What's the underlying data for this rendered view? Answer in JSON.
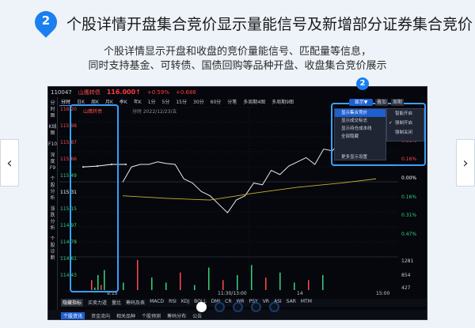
{
  "header": {
    "badge_number": "2",
    "title": "个股详情开盘集合竞价显示量能信号及新增部分证券集合竞价",
    "subtitle_line1": "个股详情显示开盘和收盘的竞价量能信号、匹配量等信息，",
    "subtitle_line2": "同时支持基金、可转债、国债回购等品种开盘、收盘集合竞价展示"
  },
  "nav": {
    "prev": "‹",
    "next": "›"
  },
  "terminal": {
    "code": "110047",
    "name": "山鹰转债",
    "price": "116.000↑",
    "change_pct": "+0.59%",
    "change_abs": "+0.686",
    "left_tabs": [
      "分时图",
      "K线图",
      "F10",
      "深度F9",
      "个股分析",
      "涨跌分析",
      "个股诊断"
    ],
    "period_tabs": [
      "分时",
      "日K",
      "周K",
      "月K",
      "季K",
      "年K",
      "1分",
      "5分",
      "15分",
      "30分",
      "60分",
      "分笔",
      "多周期4图",
      "多周期9图"
    ],
    "auction_label": "山鹰转债",
    "date_label": "分时 2022/12/23/五",
    "left_axis": [
      "116.20",
      "115.98",
      "115.87",
      "115.66",
      "115.49",
      "115.31",
      "115.15",
      "114.97",
      "114.78",
      "114.61",
      "114.43"
    ],
    "right_axis": [
      {
        "text": "0.47%",
        "color": "#ff4b4b"
      },
      {
        "text": "0.31%",
        "color": "#ff4b4b"
      },
      {
        "text": "0.16%",
        "color": "#ff4b4b"
      },
      {
        "text": "0.00%",
        "color": "#ffffff"
      },
      {
        "text": "0.16%",
        "color": "#3ad07a"
      },
      {
        "text": "0.31%",
        "color": "#3ad07a"
      },
      {
        "text": "0.47%",
        "color": "#3ad07a"
      },
      {
        "text": "1281",
        "color": "#c5c9d2"
      },
      {
        "text": "854",
        "color": "#c5c9d2"
      },
      {
        "text": "427",
        "color": "#c5c9d2"
      }
    ],
    "time_labels": [
      "9:15",
      "11:30/13:00",
      "14",
      "15:00"
    ],
    "indicators": [
      "隐藏指标",
      "买卖力道",
      "量比",
      "筹码及表",
      "MACD",
      "RSI",
      "KDJ",
      "BOLL",
      "DMI",
      "CR",
      "WR",
      "PSY",
      "VR",
      "ASI",
      "SAR",
      "MTM"
    ],
    "status_tabs": [
      "个股资讯",
      "资金流向",
      "相关品种",
      "个股预测",
      "筹码分布",
      "公告"
    ],
    "show_button": "显示▼",
    "add_button": "叠加",
    "sub_button": "周期",
    "menu_items": [
      "显示集合竞价",
      "显示成交标志",
      "显示持仓成本线",
      "全部隐藏",
      "更多显示设置"
    ],
    "submenu_items": [
      "智能开启",
      "强制开启",
      "强制关闭"
    ],
    "step_badge": "2"
  },
  "pager": {
    "count": 5,
    "active": 0
  },
  "chart_data": {
    "type": "line",
    "title": "",
    "xlabel": "",
    "ylabel": "",
    "series": [
      {
        "values": [
          [
            0,
            115.31
          ],
          [
            3,
            115.49
          ],
          [
            6,
            115.52
          ],
          [
            9,
            115.52
          ],
          [
            12,
            115.55
          ],
          [
            15,
            115.53
          ],
          [
            18,
            115.52
          ],
          [
            21,
            115.35
          ],
          [
            24,
            115.3
          ],
          [
            27,
            115.2
          ],
          [
            30,
            115.15
          ],
          [
            33,
            115.05
          ],
          [
            36,
            114.95
          ],
          [
            39,
            115.1
          ],
          [
            42,
            115.15
          ],
          [
            45,
            115.3
          ],
          [
            48,
            115.28
          ],
          [
            51,
            115.45
          ],
          [
            54,
            115.4
          ],
          [
            57,
            115.5
          ],
          [
            60,
            115.55
          ],
          [
            63,
            115.6
          ],
          [
            66,
            115.52
          ],
          [
            69,
            115.7
          ],
          [
            72,
            115.68
          ],
          [
            75,
            115.8
          ],
          [
            78,
            115.9
          ],
          [
            81,
            115.95
          ],
          [
            84,
            116.0
          ],
          [
            87,
            115.98
          ]
        ]
      },
      {
        "values": [
          [
            0,
            115.15
          ],
          [
            15,
            115.12
          ],
          [
            30,
            115.1
          ],
          [
            45,
            115.18
          ],
          [
            60,
            115.25
          ],
          [
            75,
            115.3
          ],
          [
            87,
            115.35
          ]
        ]
      }
    ],
    "auction": [
      [
        0,
        115.49
      ],
      [
        5,
        115.5
      ],
      [
        10,
        115.52
      ],
      [
        15,
        115.52
      ]
    ],
    "volume": [
      40,
      10,
      60,
      20,
      80,
      30,
      120,
      50,
      30,
      70,
      20,
      90,
      40,
      60,
      100,
      50,
      70,
      30,
      40,
      60
    ],
    "ylim": [
      114.43,
      116.2
    ]
  }
}
